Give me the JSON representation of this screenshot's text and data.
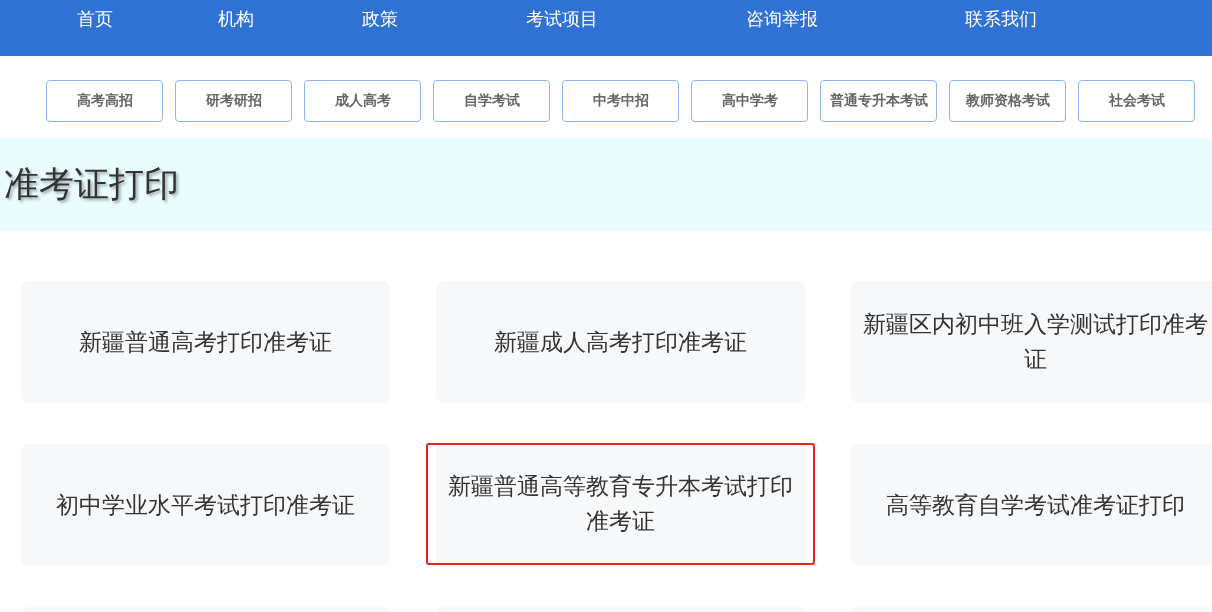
{
  "nav": [
    {
      "label": "首页"
    },
    {
      "label": "机构"
    },
    {
      "label": "政策"
    },
    {
      "label": "考试项目"
    },
    {
      "label": "咨询举报"
    },
    {
      "label": "联系我们"
    }
  ],
  "categories": [
    {
      "label": "高考高招"
    },
    {
      "label": "研考研招"
    },
    {
      "label": "成人高考"
    },
    {
      "label": "自学考试"
    },
    {
      "label": "中考中招"
    },
    {
      "label": "高中学考"
    },
    {
      "label": "普通专升本考试"
    },
    {
      "label": "教师资格考试"
    },
    {
      "label": "社会考试"
    }
  ],
  "banner": {
    "title": "准考证打印"
  },
  "cards": [
    {
      "kind": "link",
      "title": "新疆普通高考打印准考证",
      "highlighted": false
    },
    {
      "kind": "link",
      "title": "新疆成人高考打印准考证",
      "highlighted": false
    },
    {
      "kind": "link",
      "title": "新疆区内初中班入学测试打印准考证",
      "highlighted": false
    },
    {
      "kind": "link",
      "title": "初中学业水平考试打印准考证",
      "highlighted": false
    },
    {
      "kind": "link",
      "title": "新疆普通高等教育专升本考试打印准考证",
      "highlighted": true
    },
    {
      "kind": "link",
      "title": "高等教育自学考试准考证打印",
      "highlighted": false
    },
    {
      "kind": "cut"
    },
    {
      "kind": "cut"
    },
    {
      "kind": "cut"
    }
  ]
}
